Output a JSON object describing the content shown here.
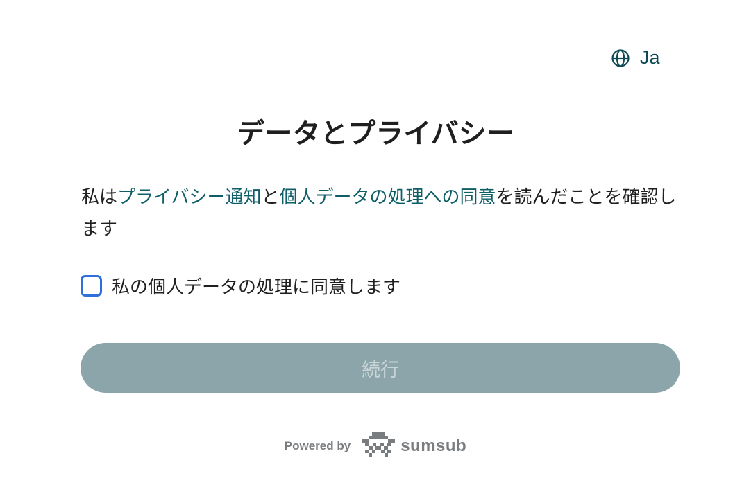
{
  "language": {
    "icon": "globe-icon",
    "label": "Ja"
  },
  "title": "データとプライバシー",
  "consent": {
    "prefix": "私は",
    "privacy_link": "プライバシー通知",
    "connector": "と",
    "processing_link": "個人データの処理への同意",
    "suffix": "を読んだことを確認します"
  },
  "checkbox": {
    "label": "私の個人データの処理に同意します",
    "checked": false
  },
  "continue_button": {
    "label": "続行",
    "disabled": true
  },
  "footer": {
    "powered_by": "Powered by",
    "brand": "sumsub",
    "brand_icon": "sumsub-logo-icon"
  },
  "colors": {
    "link": "#0e5e68",
    "checkbox_border": "#2f6fdb",
    "button_disabled": "#8ba5aa"
  }
}
